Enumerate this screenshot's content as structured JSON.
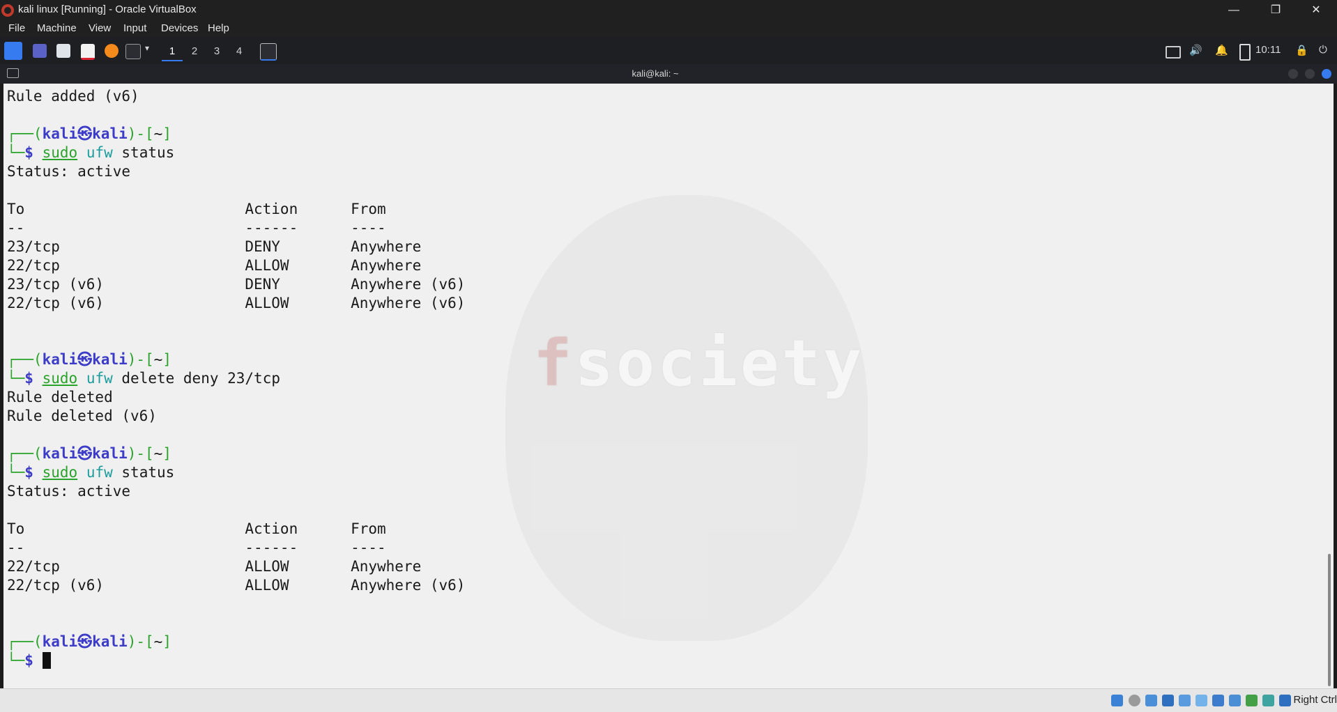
{
  "window": {
    "title": "kali linux [Running] - Oracle VirtualBox",
    "minimize_glyph": "—",
    "restore_glyph": "❐",
    "close_glyph": "✕"
  },
  "menu": [
    "File",
    "Machine",
    "View",
    "Input",
    "Devices",
    "Help"
  ],
  "panel": {
    "workspaces": [
      "1",
      "2",
      "3",
      "4"
    ],
    "active_workspace": "1",
    "clock": "10:11",
    "icons": [
      "kali-menu-icon",
      "desktop-icon",
      "file-manager-icon",
      "text-editor-icon",
      "firefox-icon",
      "terminal-icon",
      "chevron-down-icon",
      "terminal-task-icon",
      "display-icon",
      "volume-icon",
      "notifications-icon",
      "battery-icon",
      "lock-icon",
      "power-icon"
    ]
  },
  "terminal": {
    "title": "kali@kali: ~",
    "watermark": "fsociety",
    "prompt": {
      "open": "┌──(",
      "user": "kali",
      "sep": "㉿",
      "host": "kali",
      "mid": ")-[",
      "dir": "~",
      "close": "]",
      "second": "└─",
      "dollar": "$ "
    },
    "output": {
      "rule_added_v6": "Rule added (v6)",
      "status_cmd": {
        "sudo": "sudo",
        "tool": "ufw",
        "args": " status"
      },
      "status_active": "Status: active",
      "table_header": "To                         Action      From",
      "table_divider": "--                         ------      ----",
      "rows_before": [
        "23/tcp                     DENY        Anywhere",
        "22/tcp                     ALLOW       Anywhere",
        "23/tcp (v6)                DENY        Anywhere (v6)",
        "22/tcp (v6)                ALLOW       Anywhere (v6)"
      ],
      "delete_cmd": {
        "sudo": "sudo",
        "tool": "ufw",
        "args": " delete deny 23/tcp"
      },
      "rule_deleted": "Rule deleted",
      "rule_deleted_v6": "Rule deleted (v6)",
      "rows_after": [
        "22/tcp                     ALLOW       Anywhere",
        "22/tcp (v6)                ALLOW       Anywhere (v6)"
      ]
    }
  },
  "statusbar": {
    "host_key": "Right Ctrl",
    "icons": [
      "hard-disk-icon",
      "optical-drive-icon",
      "audio-icon",
      "network-icon",
      "usb-icon",
      "shared-folders-icon",
      "display-status-icon",
      "recording-icon",
      "cpu-icon",
      "mouse-integration-icon",
      "keyboard-icon"
    ],
    "colors": {
      "accent": "#367bf0",
      "prompt_green": "#2aa32a",
      "prompt_blue": "#3c3cc8",
      "tool_cyan": "#1c9c9c"
    }
  }
}
